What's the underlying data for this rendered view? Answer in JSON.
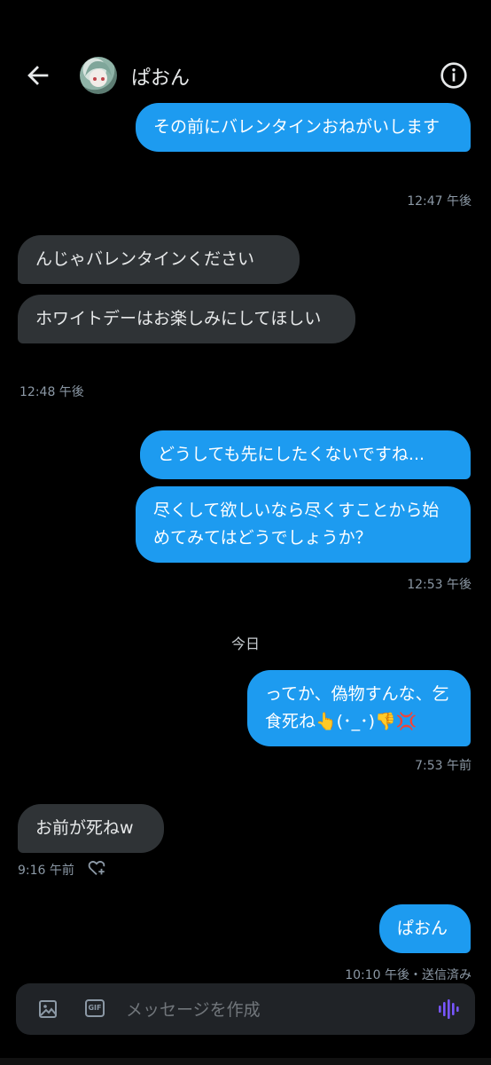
{
  "header": {
    "title": "ぱおん",
    "back_icon": "arrow-left-icon",
    "info_icon": "info-icon"
  },
  "messages": [
    {
      "dir": "out",
      "text": "その前にバレンタインおねがいします"
    },
    {
      "ts": "12:47 午後"
    },
    {
      "dir": "in",
      "text": "んじゃバレンタインください"
    },
    {
      "dir": "in",
      "text": "ホワイトデーはお楽しみにしてほしい"
    },
    {
      "ts": "12:48 午後"
    },
    {
      "dir": "out",
      "text": "どうしても先にしたくないですね..."
    },
    {
      "dir": "out",
      "text": "尽くして欲しいなら尽くすことから始めてみてはどうでしょうか？"
    },
    {
      "ts": "12:53 午後"
    }
  ],
  "day_separator": "今日",
  "today_messages": [
    {
      "dir": "out",
      "text": "ってか、偽物すんな、乞食死ね👆(･_･)👎💢"
    },
    {
      "ts": "7:53 午前"
    },
    {
      "dir": "in",
      "text": "お前が死ねw"
    },
    {
      "ts": "9:16 午前"
    },
    {
      "dir": "out",
      "text": "ぱおん"
    },
    {
      "ts": "10:10 午後・送信済み"
    }
  ],
  "reaction_icon": "add-reaction-heart-icon",
  "composer": {
    "placeholder": "メッセージを作成",
    "image_icon": "image-icon",
    "gif_label": "GIF",
    "voice_icon": "voice-waveform-icon",
    "voice_color": "#7856ff"
  },
  "colors": {
    "outgoing": "#1d9bf0",
    "incoming": "#2f3336",
    "background": "#000000",
    "timestamp": "#8b98a5"
  }
}
